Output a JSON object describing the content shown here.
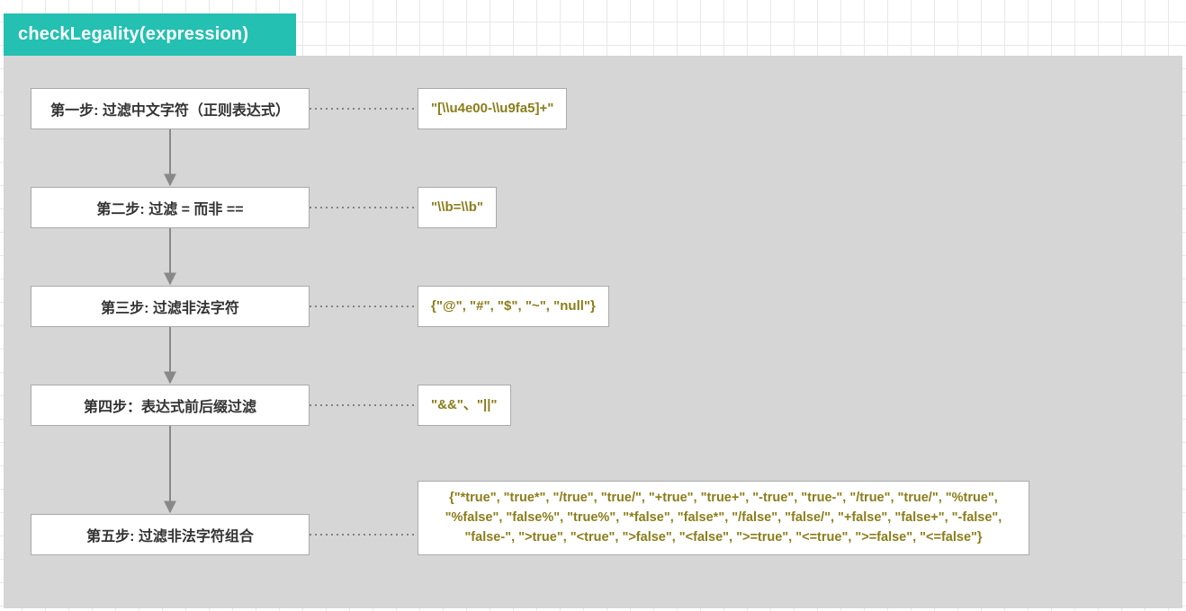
{
  "header": {
    "title": "checkLegality(expression)"
  },
  "steps": [
    {
      "label": "第一步: 过滤中文字符（正则表达式）",
      "detail": "\"[\\\\u4e00-\\\\u9fa5]+\""
    },
    {
      "label": "第二步: 过滤 = 而非 ==",
      "detail": "\"\\\\b=\\\\b\""
    },
    {
      "label": "第三步: 过滤非法字符",
      "detail": "{\"@\", \"#\", \"$\", \"~\", \"null\"}"
    },
    {
      "label": "第四步：表达式前后缀过滤",
      "detail": "\"&&\"、\"||\""
    },
    {
      "label": "第五步: 过滤非法字符组合",
      "detail": "{\"*true\", \"true*\", \"/true\", \"true/\", \"+true\", \"true+\", \"-true\", \"true-\", \"/true\", \"true/\", \"%true\", \"%false\", \"false%\", \"true%\", \"*false\", \"false*\", \"/false\", \"false/\", \"+false\", \"false+\", \"-false\", \"false-\", \">true\", \"<true\", \">false\", \"<false\", \">=true\", \"<=true\", \">=false\", \"<=false\"}"
    }
  ]
}
